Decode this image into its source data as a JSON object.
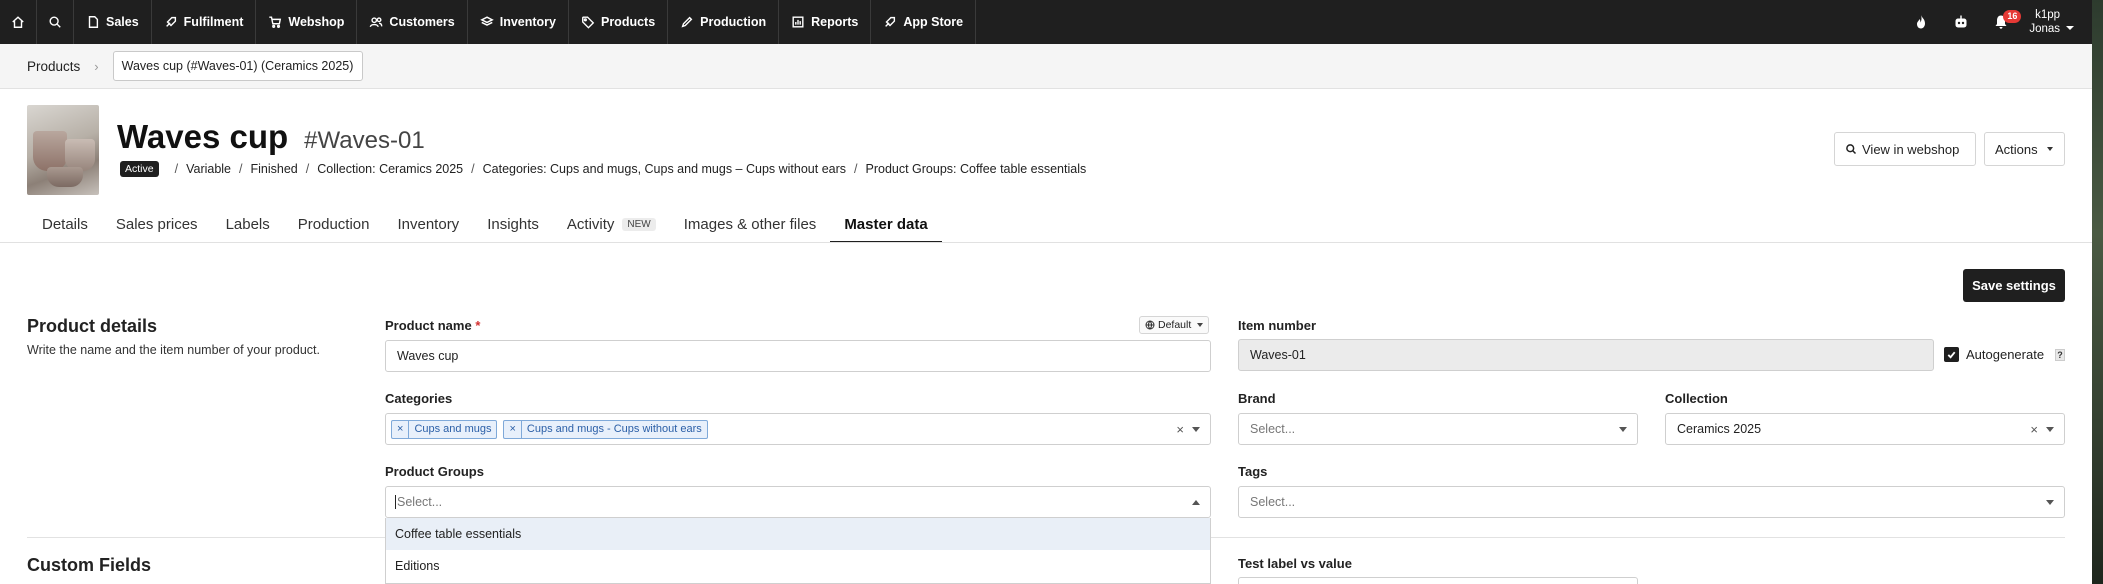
{
  "nav": {
    "items": [
      {
        "label": "Sales",
        "icon": "document-icon"
      },
      {
        "label": "Fulfilment",
        "icon": "rocket-icon"
      },
      {
        "label": "Webshop",
        "icon": "cart-icon"
      },
      {
        "label": "Customers",
        "icon": "users-icon"
      },
      {
        "label": "Inventory",
        "icon": "layers-icon"
      },
      {
        "label": "Products",
        "icon": "tag-icon"
      },
      {
        "label": "Production",
        "icon": "pencil-icon"
      },
      {
        "label": "Reports",
        "icon": "chart-icon"
      },
      {
        "label": "App Store",
        "icon": "rocket-icon"
      }
    ],
    "notifications_count": "16",
    "user_line1": "k1pp",
    "user_line2": "Jonas"
  },
  "breadcrumb": {
    "root": "Products",
    "current": "Waves cup (#Waves-01) (Ceramics 2025)"
  },
  "product": {
    "name": "Waves cup",
    "sku": "#Waves-01",
    "status": "Active",
    "meta": [
      "Variable",
      "Finished",
      "Collection: Ceramics 2025",
      "Categories: Cups and mugs, Cups and mugs – Cups without ears",
      "Product Groups: Coffee table essentials"
    ]
  },
  "header_buttons": {
    "view_webshop": "View in webshop",
    "actions": "Actions"
  },
  "tabs": [
    {
      "label": "Details"
    },
    {
      "label": "Sales prices"
    },
    {
      "label": "Labels"
    },
    {
      "label": "Production"
    },
    {
      "label": "Inventory"
    },
    {
      "label": "Insights"
    },
    {
      "label": "Activity",
      "badge": "NEW"
    },
    {
      "label": "Images & other files"
    },
    {
      "label": "Master data",
      "active": true
    }
  ],
  "save_label": "Save settings",
  "product_details": {
    "title": "Product details",
    "description": "Write the name and the item number of your product."
  },
  "form": {
    "product_name_label": "Product name",
    "required_mark": "*",
    "language": "Default",
    "product_name_value": "Waves cup",
    "item_number_label": "Item number",
    "item_number_value": "Waves-01",
    "autogenerate_label": "Autogenerate",
    "help_mark": "?",
    "categories_label": "Categories",
    "categories": [
      "Cups and mugs",
      "Cups and mugs - Cups without ears"
    ],
    "brand_label": "Brand",
    "brand_placeholder": "Select...",
    "collection_label": "Collection",
    "collection_value": "Ceramics 2025",
    "product_groups_label": "Product Groups",
    "product_groups_placeholder": "Select...",
    "product_groups_options": [
      "Coffee table essentials",
      "Editions"
    ],
    "tags_label": "Tags",
    "tags_placeholder": "Select...",
    "test_label": "Test label vs value"
  },
  "custom_fields": {
    "title": "Custom Fields"
  },
  "chip_remove": "×",
  "clear_mark": "×"
}
